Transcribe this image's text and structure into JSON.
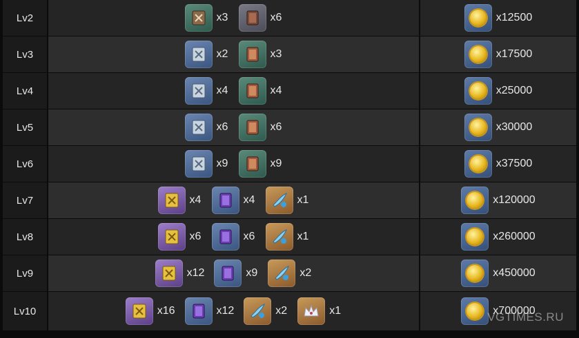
{
  "colors": {
    "background": "#0b0b0b",
    "level_cell": "#1b1b1b",
    "row_odd": "#252525",
    "row_even": "#2e2e2e",
    "text": "#e8e8e8"
  },
  "rows": [
    {
      "level": "Lv2",
      "materials": [
        {
          "icon": "teachings-book-brown-icon",
          "rarity": "green",
          "qty": "x3"
        },
        {
          "icon": "slime-condensate-icon",
          "rarity": "grey",
          "qty": "x6"
        }
      ],
      "mora": "x12500"
    },
    {
      "level": "Lv3",
      "materials": [
        {
          "icon": "guide-book-blue-icon",
          "rarity": "blue",
          "qty": "x2"
        },
        {
          "icon": "slime-secretions-icon",
          "rarity": "green",
          "qty": "x3"
        }
      ],
      "mora": "x17500"
    },
    {
      "level": "Lv4",
      "materials": [
        {
          "icon": "guide-book-blue-icon",
          "rarity": "blue",
          "qty": "x4"
        },
        {
          "icon": "slime-secretions-icon",
          "rarity": "green",
          "qty": "x4"
        }
      ],
      "mora": "x25000"
    },
    {
      "level": "Lv5",
      "materials": [
        {
          "icon": "guide-book-blue-icon",
          "rarity": "blue",
          "qty": "x6"
        },
        {
          "icon": "slime-secretions-icon",
          "rarity": "green",
          "qty": "x6"
        }
      ],
      "mora": "x30000"
    },
    {
      "level": "Lv6",
      "materials": [
        {
          "icon": "guide-book-blue-icon",
          "rarity": "blue",
          "qty": "x9"
        },
        {
          "icon": "slime-secretions-icon",
          "rarity": "green",
          "qty": "x9"
        }
      ],
      "mora": "x37500"
    },
    {
      "level": "Lv7",
      "materials": [
        {
          "icon": "philosophies-book-gold-icon",
          "rarity": "purple",
          "qty": "x4"
        },
        {
          "icon": "slime-concentrate-icon",
          "rarity": "blue",
          "qty": "x4"
        },
        {
          "icon": "boss-drop-feather-icon",
          "rarity": "orange",
          "qty": "x1"
        }
      ],
      "mora": "x120000"
    },
    {
      "level": "Lv8",
      "materials": [
        {
          "icon": "philosophies-book-gold-icon",
          "rarity": "purple",
          "qty": "x6"
        },
        {
          "icon": "slime-concentrate-icon",
          "rarity": "blue",
          "qty": "x6"
        },
        {
          "icon": "boss-drop-feather-icon",
          "rarity": "orange",
          "qty": "x1"
        }
      ],
      "mora": "x260000"
    },
    {
      "level": "Lv9",
      "materials": [
        {
          "icon": "philosophies-book-gold-icon",
          "rarity": "purple",
          "qty": "x12"
        },
        {
          "icon": "slime-concentrate-icon",
          "rarity": "blue",
          "qty": "x9"
        },
        {
          "icon": "boss-drop-feather-icon",
          "rarity": "orange",
          "qty": "x2"
        }
      ],
      "mora": "x450000"
    },
    {
      "level": "Lv10",
      "materials": [
        {
          "icon": "philosophies-book-gold-icon",
          "rarity": "purple",
          "qty": "x16"
        },
        {
          "icon": "slime-concentrate-icon",
          "rarity": "blue",
          "qty": "x12"
        },
        {
          "icon": "boss-drop-feather-icon",
          "rarity": "orange",
          "qty": "x2"
        },
        {
          "icon": "crown-of-insight-icon",
          "rarity": "orange",
          "qty": "x1"
        }
      ],
      "mora": "x700000"
    }
  ],
  "mora_icon": "mora-coin-icon",
  "watermark": "VGTIMES.RU"
}
